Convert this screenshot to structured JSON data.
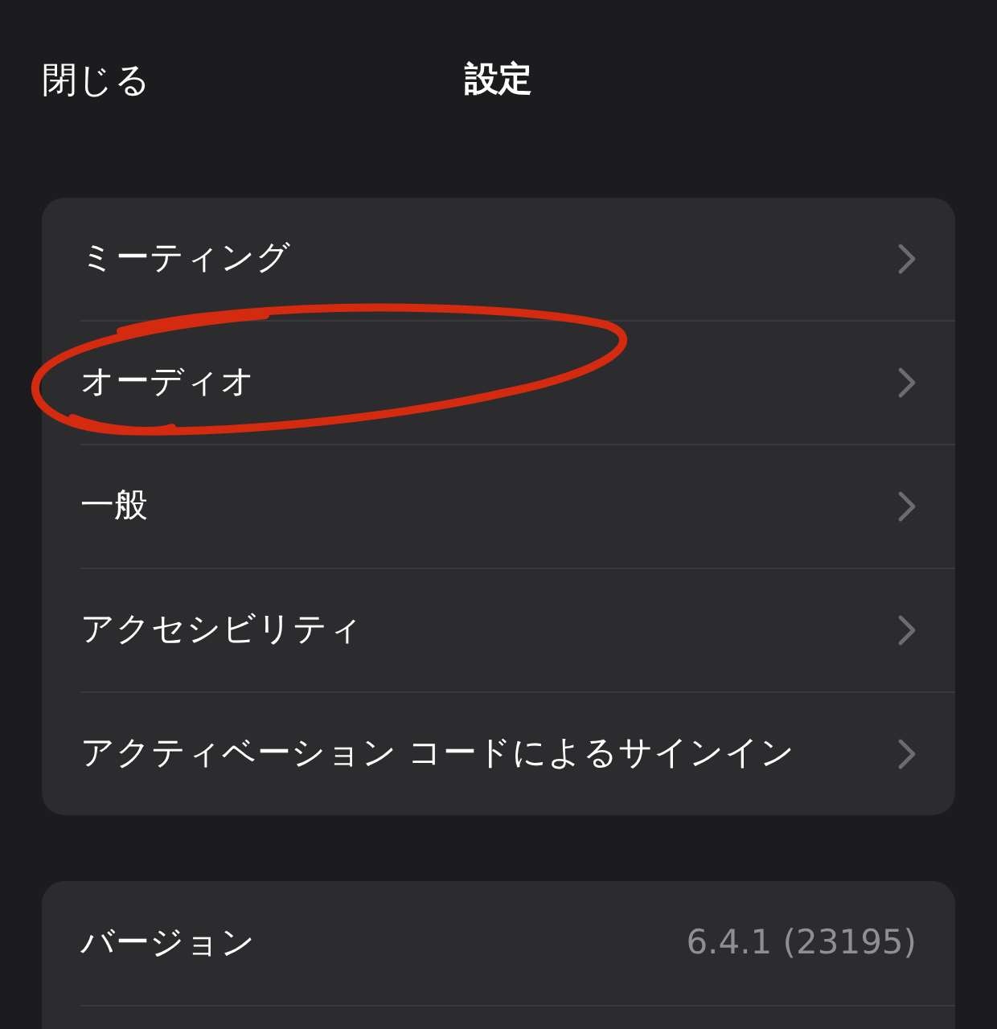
{
  "header": {
    "close": "閉じる",
    "title": "設定"
  },
  "menu": [
    {
      "label": "ミーティング"
    },
    {
      "label": "オーディオ"
    },
    {
      "label": "一般"
    },
    {
      "label": "アクセシビリティ"
    },
    {
      "label": "アクティベーション コードによるサインイン"
    }
  ],
  "info": [
    {
      "label": "バージョン",
      "value": "6.4.1 (23195)"
    }
  ]
}
